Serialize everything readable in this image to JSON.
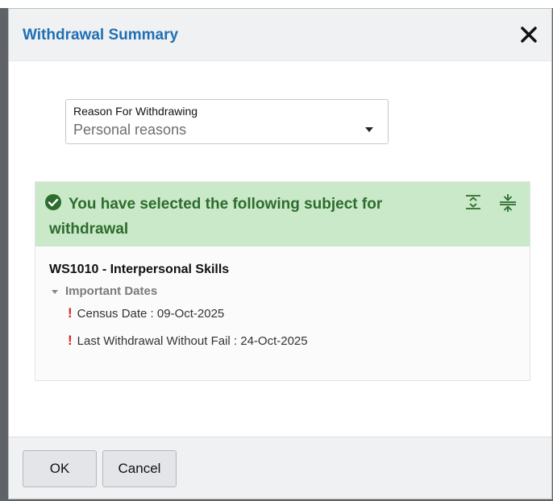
{
  "dialog": {
    "title": "Withdrawal Summary",
    "close_icon": "close-icon"
  },
  "reason_select": {
    "label": "Reason For Withdrawing",
    "value": "Personal reasons"
  },
  "summary_panel": {
    "message": "You have selected the following subject for withdrawal",
    "status_icon": "check-circle-icon",
    "expand_icon": "expand-all-icon",
    "collapse_icon": "collapse-all-icon",
    "accent_color": "#2e6b2e",
    "background_color": "#c9e9c8"
  },
  "subject": {
    "title": "WS1010 - Interpersonal Skills",
    "dates_heading": "Important Dates",
    "dates": [
      {
        "text": "Census Date : 09-Oct-2025"
      },
      {
        "text": "Last Withdrawal Without Fail : 24-Oct-2025"
      }
    ],
    "warning_color": "#e02020"
  },
  "footer": {
    "ok_label": "OK",
    "cancel_label": "Cancel"
  }
}
